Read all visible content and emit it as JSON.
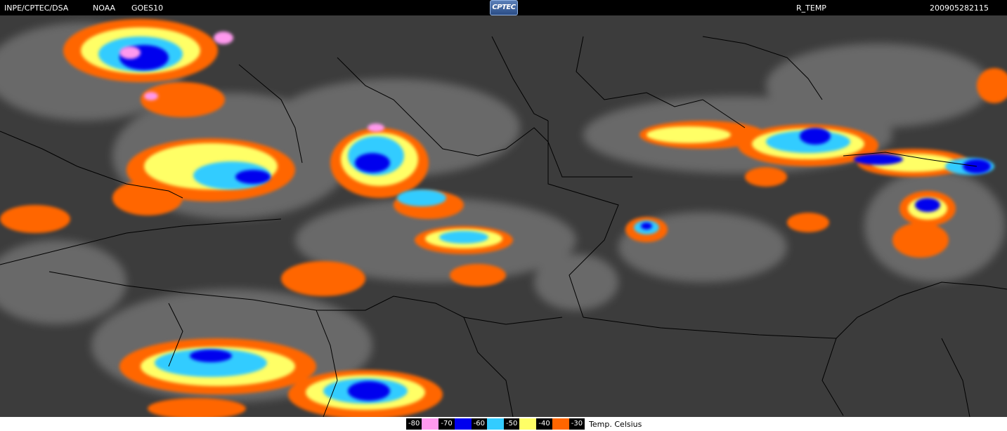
{
  "header": {
    "source": "INPE/CPTEC/DSA",
    "agency": "NOAA",
    "satellite": "GOES10",
    "logo_text": "CPTEC",
    "product": "R_TEMP",
    "timestamp": "200905282115"
  },
  "legend": {
    "entries": [
      {
        "label": "-80",
        "color": "#ff99ee"
      },
      {
        "label": "-70",
        "color": "#0000ee"
      },
      {
        "label": "-60",
        "color": "#33ccff"
      },
      {
        "label": "-50",
        "color": "#ffff66"
      },
      {
        "label": "-40",
        "color": "#ff6600"
      },
      {
        "label": "-30",
        "color": ""
      }
    ],
    "unit": "Temp. Celsius"
  },
  "colors": {
    "background_cloud_free": "#3c3c3c",
    "cloud_gray": "#9a9a9a",
    "border_lines": "#000000"
  }
}
